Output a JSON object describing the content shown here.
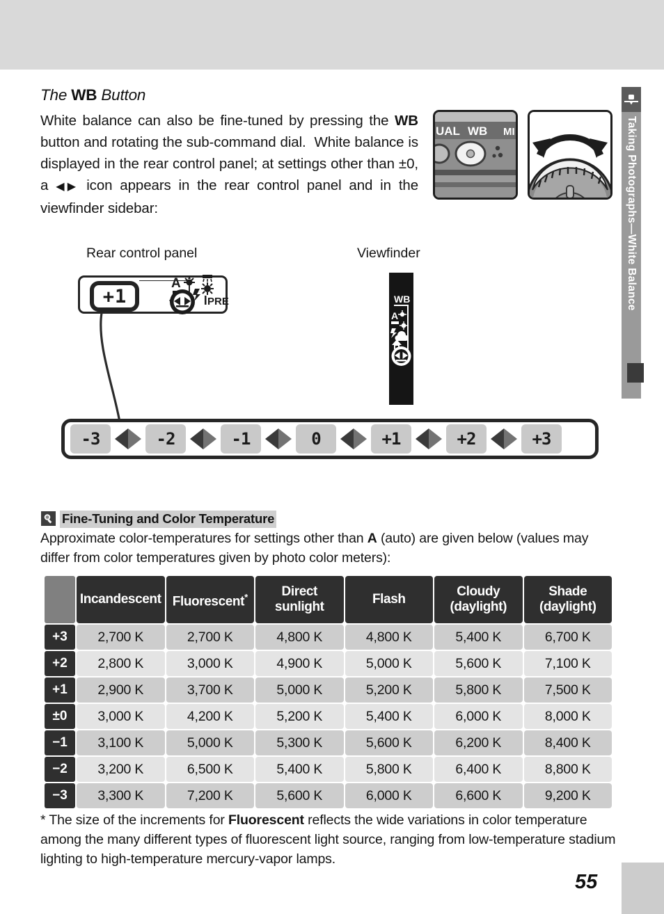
{
  "sidebar": {
    "chapter_label": "Taking Photographs—White Balance",
    "icon": "camera-icon"
  },
  "content": {
    "heading_prefix": "The ",
    "heading_bold": "WB",
    "heading_suffix": " Button",
    "intro_paragraph": "White balance can also be fine-tuned by pressing the WB button and rotating the sub-command dial.  White balance is displayed in the rear control panel; at settings other than ±0, a ◀▶ icon appears in the rear control panel and in the viewfinder sidebar:"
  },
  "figures": {
    "rear_control_panel_label": "Rear control panel",
    "viewfinder_label": "Viewfinder",
    "rear_panel_value": "+1",
    "rear_panel_modes": [
      "A",
      "PRE"
    ],
    "viewfinder_wb_label": "WB",
    "photo_wb_button_texts": [
      "UAL",
      "WB",
      "MI"
    ],
    "photo_wb_caption": "wb-button-photo",
    "photo_dial_caption": "sub-command-dial-photo"
  },
  "lcd_strip": {
    "steps": [
      "-3",
      "-2",
      "-1",
      "0",
      "+1",
      "+2",
      "+3"
    ],
    "separator_icon": "left-right-arrow-icon"
  },
  "tip": {
    "icon": "magnifier-icon",
    "title": "Fine-Tuning and Color Temperature",
    "body_before_bold": "Approximate color-temperatures for settings other than ",
    "body_bold": "A",
    "body_after_bold": " (auto) are given below (values may differ from color temperatures given by photo color meters):"
  },
  "table": {
    "corner": "",
    "columns": [
      {
        "line1": "Incandescent",
        "line2": ""
      },
      {
        "line1": "Fluorescent",
        "line2": "",
        "superscript": "*"
      },
      {
        "line1": "Direct",
        "line2": "sunlight"
      },
      {
        "line1": "Flash",
        "line2": ""
      },
      {
        "line1": "Cloudy",
        "line2": "(daylight)"
      },
      {
        "line1": "Shade",
        "line2": "(daylight)"
      }
    ],
    "rows": [
      {
        "label": "+3",
        "values": [
          "2,700 K",
          "2,700 K",
          "4,800 K",
          "4,800 K",
          "5,400 K",
          "6,700 K"
        ]
      },
      {
        "label": "+2",
        "values": [
          "2,800 K",
          "3,000 K",
          "4,900 K",
          "5,000 K",
          "5,600 K",
          "7,100 K"
        ]
      },
      {
        "label": "+1",
        "values": [
          "2,900 K",
          "3,700 K",
          "5,000 K",
          "5,200 K",
          "5,800 K",
          "7,500 K"
        ]
      },
      {
        "label": "±0",
        "values": [
          "3,000 K",
          "4,200 K",
          "5,200 K",
          "5,400 K",
          "6,000 K",
          "8,000 K"
        ]
      },
      {
        "label": "−1",
        "values": [
          "3,100 K",
          "5,000 K",
          "5,300 K",
          "5,600 K",
          "6,200 K",
          "8,400 K"
        ]
      },
      {
        "label": "−2",
        "values": [
          "3,200 K",
          "6,500 K",
          "5,400 K",
          "5,800 K",
          "6,400 K",
          "8,800 K"
        ]
      },
      {
        "label": "−3",
        "values": [
          "3,300 K",
          "7,200 K",
          "5,600 K",
          "6,000 K",
          "6,600 K",
          "9,200 K"
        ]
      }
    ]
  },
  "footnote": {
    "marker": "*",
    "line1_before_bold": " The size of the increments for ",
    "line1_bold": "Fluorescent",
    "line1_after_bold": " reflects the wide variations in color temperature among the many different types of fluorescent light source, ranging from low-temperature stadium lighting to high-temperature mercury-vapor lamps."
  },
  "page_number": "55",
  "colors": {
    "top_band": "#d9d9d9",
    "tab_gray": "#9a9a9a",
    "table_header": "#2f2f2f",
    "row_light": "#e4e4e4",
    "row_dark": "#cdcdcd"
  }
}
